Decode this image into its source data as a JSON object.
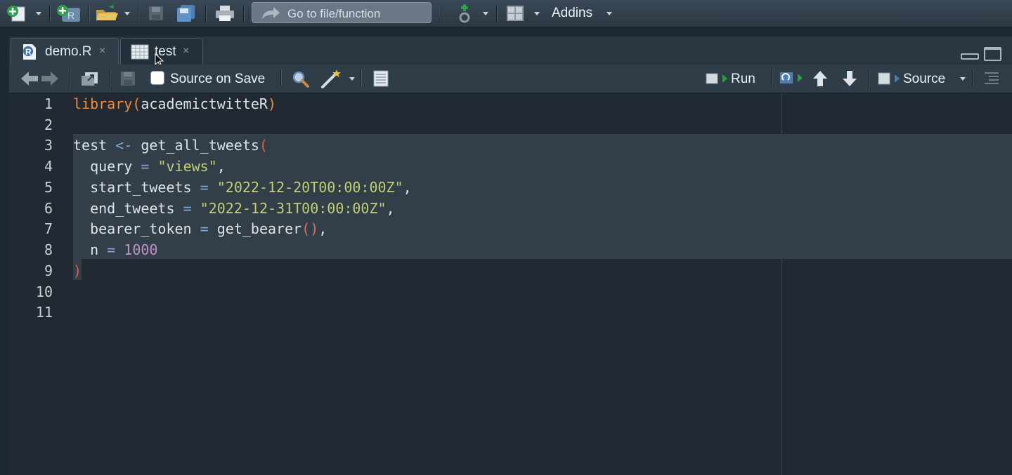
{
  "main_toolbar": {
    "goto_placeholder": "Go to file/function",
    "addins_label": "Addins"
  },
  "tabs": [
    {
      "label": "demo.R",
      "close": "×",
      "icon": "r-file-icon"
    },
    {
      "label": "test",
      "close": "×",
      "icon": "table-icon"
    }
  ],
  "editor_toolbar": {
    "source_on_save_label": "Source on Save",
    "source_on_save_checked": false,
    "run_label": "Run",
    "source_label": "Source"
  },
  "gutter": [
    "1",
    "2",
    "3",
    "4",
    "5",
    "6",
    "7",
    "8",
    "9",
    "10",
    "11"
  ],
  "code": {
    "l1": {
      "fn": "library",
      "open": "(",
      "arg": "academictwitteR",
      "close": ")"
    },
    "l3": {
      "var": "test",
      "assign": "<-",
      "fn": "get_all_tweets",
      "open": "("
    },
    "l4": {
      "arg": "query",
      "eq": "=",
      "val": "\"views\"",
      "comma": ","
    },
    "l5": {
      "arg": "start_tweets",
      "eq": "=",
      "val": "\"2022-12-20T00:00:00Z\"",
      "comma": ","
    },
    "l6": {
      "arg": "end_tweets",
      "eq": "=",
      "val": "\"2022-12-31T00:00:00Z\"",
      "comma": ","
    },
    "l7": {
      "arg": "bearer_token",
      "eq": "=",
      "fn": "get_bearer",
      "parens": "()",
      "comma": ","
    },
    "l8": {
      "arg": "n",
      "eq": "=",
      "val": "1000"
    },
    "l9": {
      "close": ")"
    }
  },
  "colors": {
    "function": "#f08c3c",
    "operator": "#7fa8d8",
    "string": "#c3cf74",
    "number": "#c28fc5",
    "paren_highlight": "#e05a4a"
  }
}
